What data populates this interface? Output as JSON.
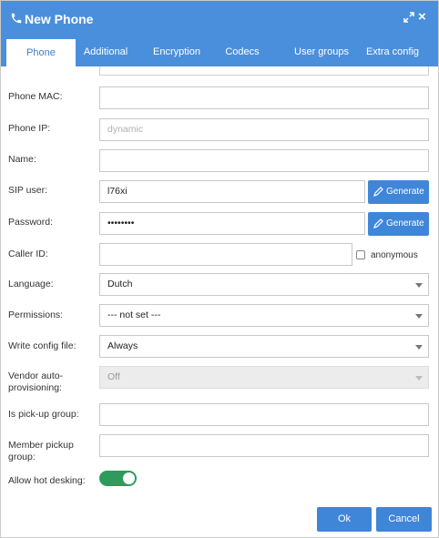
{
  "window": {
    "title": "New Phone",
    "close_glyph": "×",
    "phone_icon": "phone-icon",
    "expand_icon": "expand-icon"
  },
  "tabs": [
    {
      "label": "Phone",
      "active": true
    },
    {
      "label": "Additional"
    },
    {
      "label": "Encryption"
    },
    {
      "label": "Codecs"
    },
    {
      "label": "User groups"
    },
    {
      "label": "Extra config"
    }
  ],
  "form": {
    "phone_mac": {
      "label": "Phone MAC:",
      "value": ""
    },
    "phone_ip": {
      "label": "Phone IP:",
      "value": "",
      "placeholder": "dynamic"
    },
    "name": {
      "label": "Name:",
      "value": ""
    },
    "sip_user": {
      "label": "SIP user:",
      "value": "l76xi",
      "generate_label": "Generate"
    },
    "password": {
      "label": "Password:",
      "value": "••••••••",
      "generate_label": "Generate"
    },
    "caller_id": {
      "label": "Caller ID:",
      "value": "",
      "anonymous_label": "anonymous",
      "anonymous_checked": false
    },
    "language": {
      "label": "Language:",
      "value": "Dutch"
    },
    "permissions": {
      "label": "Permissions:",
      "value": "--- not set ---"
    },
    "write_config": {
      "label": "Write config file:",
      "value": "Always"
    },
    "vendor_auto": {
      "label_line1": "Vendor auto-",
      "label_line2": "provisioning:",
      "value": "Off"
    },
    "pickup_group": {
      "label": "Is pick-up group:",
      "value": ""
    },
    "member_pickup": {
      "label_line1": "Member pickup",
      "label_line2": "group:",
      "value": ""
    },
    "hot_desking": {
      "label": "Allow hot desking:",
      "enabled": true
    }
  },
  "buttons": {
    "ok": "Ok",
    "cancel": "Cancel"
  },
  "colors": {
    "header": "#4a8fdc",
    "button": "#3f86d8",
    "toggle_on": "#2f9a5c"
  }
}
